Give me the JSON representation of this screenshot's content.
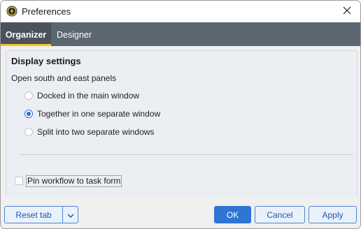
{
  "window": {
    "title": "Preferences",
    "app_icon": "lightning-bolt-icon",
    "close_icon": "close-icon"
  },
  "tabs": [
    {
      "label": "Organizer",
      "active": true
    },
    {
      "label": "Designer",
      "active": false
    }
  ],
  "display_settings": {
    "title": "Display settings",
    "panels_label": "Open south and east panels",
    "options": [
      {
        "label": "Docked in the main window",
        "checked": false
      },
      {
        "label": "Together in one separate window",
        "checked": true
      },
      {
        "label": "Split into two separate windows",
        "checked": false
      }
    ],
    "pin_workflow": {
      "label": "Pin workflow to task form",
      "checked": false
    }
  },
  "footer": {
    "reset_tab": "Reset tab",
    "dropdown_icon": "chevron-down-icon",
    "ok": "OK",
    "cancel": "Cancel",
    "apply": "Apply"
  },
  "colors": {
    "accent": "#2e75d6",
    "tab_bar": "#5c6670",
    "tab_underline": "#f2c624"
  }
}
